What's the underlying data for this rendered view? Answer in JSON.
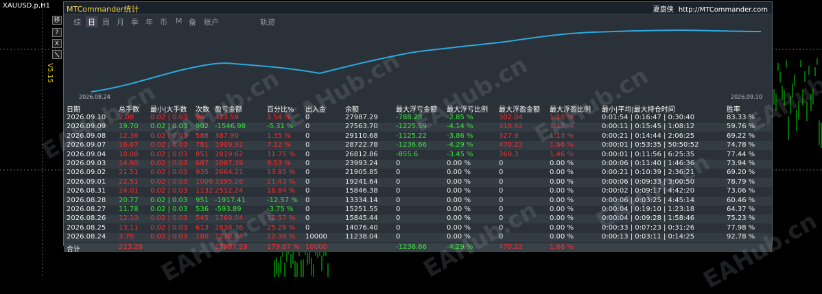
{
  "chart": {
    "symbol_title": "XAUUSD.p,H1",
    "version_label": "V5.15"
  },
  "side_buttons": [
    "移",
    "?",
    "X",
    ""
  ],
  "app": {
    "title": "MTCommander统计",
    "brand_name": "夏盘侠",
    "brand_url": "http://MTCommander.com"
  },
  "tabs": [
    {
      "label": "综",
      "active": false
    },
    {
      "label": "日",
      "active": true
    },
    {
      "label": "周",
      "active": false
    },
    {
      "label": "月",
      "active": false
    },
    {
      "label": "季",
      "active": false
    },
    {
      "label": "年",
      "active": false
    },
    {
      "label": "币",
      "active": false
    },
    {
      "label": "M",
      "active": false
    },
    {
      "label": "备",
      "active": false
    },
    {
      "label": "账户",
      "active": false
    },
    {
      "label": "轨迹",
      "active": false
    }
  ],
  "mini_chart": {
    "start_label": "2026.08.24",
    "end_label": "2026.09.10",
    "line_color": "#2aa9e0"
  },
  "table": {
    "headers": [
      "日期",
      "总手数",
      "最小|大手数",
      "次数",
      "盈亏金额",
      "百分比%",
      "出入金",
      "余额",
      "最大浮亏金额",
      "最大浮亏比例",
      "最大浮盈金额",
      "最大浮盈比例",
      "最小|平均|最大持仓时间",
      "胜率"
    ],
    "rows": [
      {
        "date": "2026.09.10",
        "lots": "2.08",
        "minmax": "0.02 | 0.03",
        "count": "96",
        "pnl": "423.59",
        "pct": "1.54 %",
        "flow": "0",
        "balance": "27987.29",
        "maxloss": "-788.28",
        "maxlosspct": "-2.85 %",
        "maxprofit": "302.04",
        "maxprofitpct": "1.10 %",
        "hold": "0:01:54 | 0:16:47 | 0:30:40",
        "win": "83.33 %",
        "color": "red"
      },
      {
        "date": "2026.09.09",
        "lots": "19.70",
        "minmax": "0.02 | 0.03",
        "count": "902",
        "pnl": "-1546.98",
        "pct": "-5.31 %",
        "flow": "0",
        "balance": "27563.70",
        "maxloss": "-1225.59",
        "maxlosspct": "-4.14 %",
        "maxprofit": "318.92",
        "maxprofitpct": "1.13 %",
        "hold": "0:00:11 | 0:15:45 | 1:08:12",
        "win": "59.76 %",
        "color": "green"
      },
      {
        "date": "2026.09.08",
        "lots": "12.36",
        "minmax": "0.02 | 0.03",
        "count": "588",
        "pnl": "387.90",
        "pct": "1.35 %",
        "flow": "0",
        "balance": "29110.68",
        "maxloss": "-1125.22",
        "maxlosspct": "-3.86 %",
        "maxprofit": "327.9",
        "maxprofitpct": "1.13 %",
        "hold": "0:00:21 | 0:14:44 | 2:06:25",
        "win": "69.22 %",
        "color": "red"
      },
      {
        "date": "2026.09.07",
        "lots": "16.67",
        "minmax": "0.02 | 0.03",
        "count": "781",
        "pnl": "1909.92",
        "pct": "7.12 %",
        "flow": "0",
        "balance": "28722.78",
        "maxloss": "-1236.66",
        "maxlosspct": "-4.29 %",
        "maxprofit": "470.22",
        "maxprofitpct": "1.66 %",
        "hold": "0:00:01 | 0:53:35 | 50:50:52",
        "win": "74.78 %",
        "color": "red"
      },
      {
        "date": "2026.09.04",
        "lots": "18.08",
        "minmax": "0.02 | 0.03",
        "count": "851",
        "pnl": "2819.62",
        "pct": "11.75 %",
        "flow": "0",
        "balance": "26812.86",
        "maxloss": "-855.6",
        "maxlosspct": "-3.45 %",
        "maxprofit": "369.3",
        "maxprofitpct": "1.46 %",
        "hold": "0:00:01 | 0:11:56 | 6:25:35",
        "win": "77.44 %",
        "color": "red"
      },
      {
        "date": "2026.09.03",
        "lots": "14.90",
        "minmax": "0.02 | 0.03",
        "count": "687",
        "pnl": "2087.39",
        "pct": "9.53 %",
        "flow": "0",
        "balance": "23993.24",
        "maxloss": "0",
        "maxlosspct": "0.00 %",
        "maxprofit": "0",
        "maxprofitpct": "0.00 %",
        "hold": "0:00:06 | 0:11:40 | 1:46:36",
        "win": "73.94 %",
        "color": "red"
      },
      {
        "date": "2026.09.02",
        "lots": "21.51",
        "minmax": "0.02 | 0.03",
        "count": "935",
        "pnl": "2664.21",
        "pct": "13.85 %",
        "flow": "0",
        "balance": "21905.85",
        "maxloss": "0",
        "maxlosspct": "0.00 %",
        "maxprofit": "0",
        "maxprofitpct": "0.00 %",
        "hold": "0:00:21 | 0:10:39 | 2:36:21",
        "win": "69.20 %",
        "color": "red"
      },
      {
        "date": "2026.09.01",
        "lots": "22.51",
        "minmax": "0.02 | 0.03",
        "count": "1009",
        "pnl": "3395.26",
        "pct": "21.43 %",
        "flow": "0",
        "balance": "19241.64",
        "maxloss": "0",
        "maxlosspct": "0.00 %",
        "maxprofit": "0",
        "maxprofitpct": "0.00 %",
        "hold": "0:00:06 | 0:09:33 | 3:00:50",
        "win": "78.79 %",
        "color": "red"
      },
      {
        "date": "2026.08.31",
        "lots": "24.01",
        "minmax": "0.02 | 0.03",
        "count": "1132",
        "pnl": "2512.24",
        "pct": "18.84 %",
        "flow": "0",
        "balance": "15846.38",
        "maxloss": "0",
        "maxlosspct": "0.00 %",
        "maxprofit": "0",
        "maxprofitpct": "0.00 %",
        "hold": "0:00:02 | 0:09:17 | 4:42:20",
        "win": "73.06 %",
        "color": "red"
      },
      {
        "date": "2026.08.28",
        "lots": "20.77",
        "minmax": "0.02 | 0.03",
        "count": "951",
        "pnl": "-1917.41",
        "pct": "-12.57 %",
        "flow": "0",
        "balance": "13334.14",
        "maxloss": "0",
        "maxlosspct": "0.00 %",
        "maxprofit": "0",
        "maxprofitpct": "0.00 %",
        "hold": "0:00:06 | 0:03:25 | 4:45:14",
        "win": "60.46 %",
        "color": "green"
      },
      {
        "date": "2026.08.27",
        "lots": "11.78",
        "minmax": "0.02 | 0.03",
        "count": "536",
        "pnl": "-593.89",
        "pct": "-3.75 %",
        "flow": "0",
        "balance": "15251.55",
        "maxloss": "0",
        "maxlosspct": "0.00 %",
        "maxprofit": "0",
        "maxprofitpct": "0.00 %",
        "hold": "0:00:04 | 0:19:10 | 1:23:18",
        "win": "64.37 %",
        "color": "green"
      },
      {
        "date": "2026.08.26",
        "lots": "12.10",
        "minmax": "0.02 | 0.03",
        "count": "545",
        "pnl": "1769.04",
        "pct": "12.57 %",
        "flow": "0",
        "balance": "15845.44",
        "maxloss": "0",
        "maxlosspct": "0.00 %",
        "maxprofit": "0",
        "maxprofitpct": "0.00 %",
        "hold": "0:00:04 | 0:09:28 | 1:58:46",
        "win": "75.23 %",
        "color": "red"
      },
      {
        "date": "2026.08.25",
        "lots": "13.11",
        "minmax": "0.02 | 0.03",
        "count": "613",
        "pnl": "2838.36",
        "pct": "25.26 %",
        "flow": "0",
        "balance": "14076.40",
        "maxloss": "0",
        "maxlosspct": "0.00 %",
        "maxprofit": "0",
        "maxprofitpct": "0.00 %",
        "hold": "0:00:33 | 0:07:23 | 0:31:26",
        "win": "77.98 %",
        "color": "red"
      },
      {
        "date": "2026.08.24",
        "lots": "3.70",
        "minmax": "0.02 | 0.03",
        "count": "180",
        "pnl": "1238.04",
        "pct": "12.38 %",
        "flow": "10000",
        "balance": "11238.04",
        "maxloss": "0",
        "maxlosspct": "0.00 %",
        "maxprofit": "0",
        "maxprofitpct": "0.00 %",
        "hold": "0:00:13 | 0:03:11 | 0:14:25",
        "win": "92.78 %",
        "color": "red"
      }
    ],
    "total": {
      "label": "合计",
      "lots": "213.28",
      "pnl": "17987.29",
      "pct": "179.87 %",
      "flow": "10000",
      "maxloss": "-1236.66",
      "maxlosspct": "-4.29 %",
      "maxprofit": "470.22",
      "maxprofitpct": "1.66 %"
    }
  },
  "watermark": "EAHub.cn"
}
